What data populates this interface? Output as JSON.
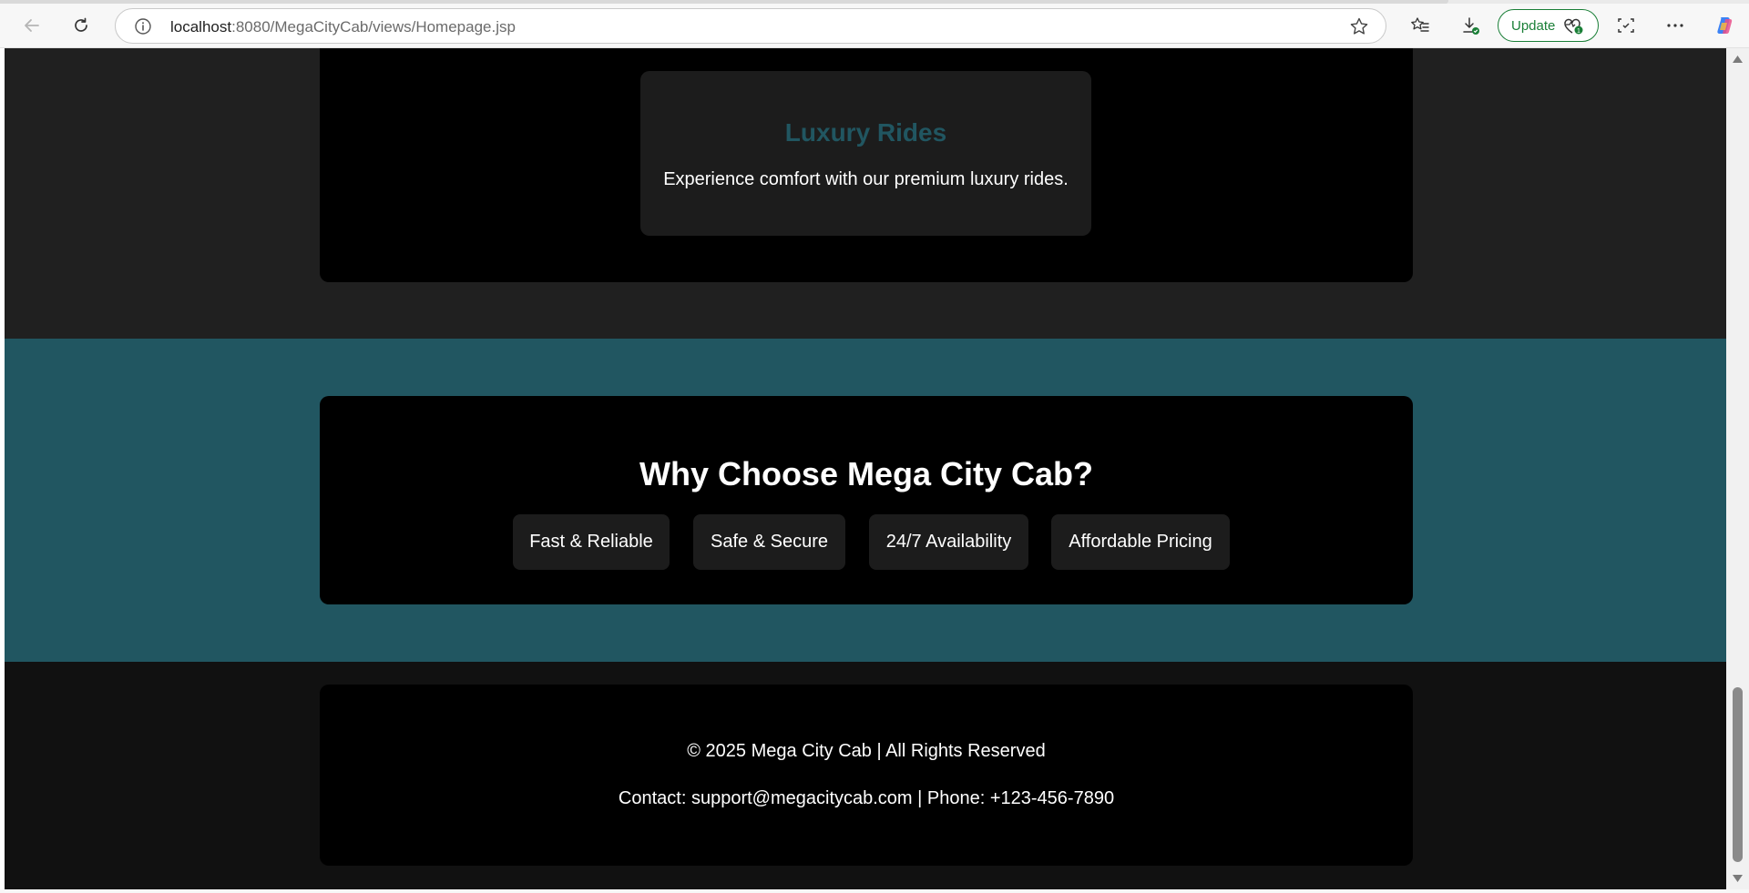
{
  "browser": {
    "url_host": "localhost",
    "url_rest": ":8080/MegaCityCab/views/Homepage.jsp",
    "update_label": "Update",
    "icons": [
      "back-arrow-icon",
      "reload-icon",
      "info-icon",
      "star-icon",
      "favorites-icon",
      "downloads-icon",
      "health-icon",
      "screenshot-icon",
      "more-icon",
      "copilot-icon"
    ]
  },
  "services": {
    "card_title": "Luxury Rides",
    "card_text": "Experience comfort with our premium luxury rides."
  },
  "why": {
    "heading": "Why Choose Mega City Cab?",
    "features": [
      "Fast & Reliable",
      "Safe & Secure",
      "24/7 Availability",
      "Affordable Pricing"
    ]
  },
  "footer": {
    "copyright": "© 2025 Mega City Cab | All Rights Reserved",
    "contact": "Contact: support@megacitycab.com | Phone: +123-456-7890"
  },
  "colors": {
    "accent_teal": "#215661",
    "dark_section": "#202020",
    "panel_black": "#000000",
    "card_gray": "#1c1c1c",
    "update_green": "#1a7f37"
  }
}
